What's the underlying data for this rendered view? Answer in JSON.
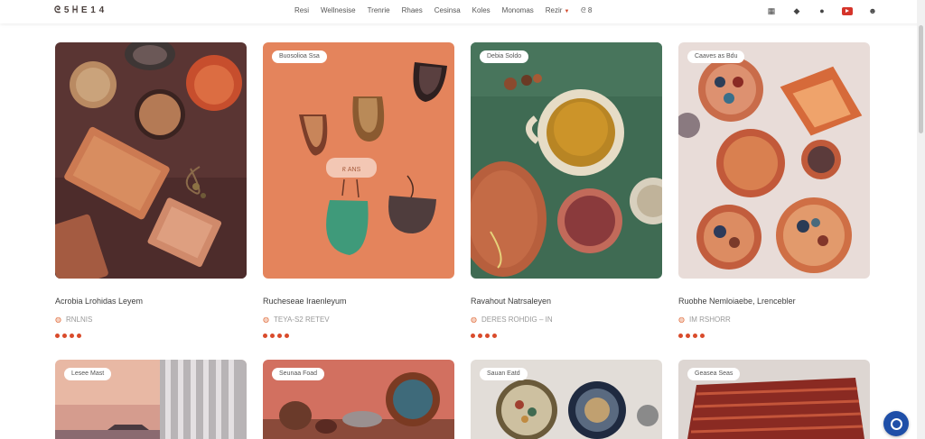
{
  "header": {
    "logo": "ᘓ 5 ᕼ E 1 4",
    "nav": [
      "Resi",
      "Wellnesise",
      "Trenrie",
      "Rhaes",
      "Cesinsa",
      "Koles",
      "Monomas",
      "Rezir"
    ],
    "nav_extra": "ᘓ 8",
    "icons": [
      "grid-icon",
      "bookmark-icon",
      "chat-icon",
      "youtube-icon",
      "user-icon"
    ]
  },
  "cards": [
    {
      "tag": "",
      "title": "Acrobia Lrohidas Leyem",
      "meta": "RNLNIS",
      "rating": 4
    },
    {
      "tag": "Buosolioa Ssa",
      "title": "Rucheseae Iraenleyum",
      "meta": "TEYA-S2 RETEV",
      "rating": 4
    },
    {
      "tag": "Debia Soldo",
      "title": "Ravahout Natrsaleyen",
      "meta": "DERES  ROHDIG – IN",
      "rating": 4
    },
    {
      "tag": "Caaves as Bdu",
      "title": "Ruobhe Nemloiaebe, Lrencebler",
      "meta": "IM RSHORR",
      "rating": 4
    },
    {
      "tag": "Lesee Mast",
      "title": "",
      "meta": "",
      "rating": 0
    },
    {
      "tag": "Seunaa Foad",
      "title": "",
      "meta": "",
      "rating": 0
    },
    {
      "tag": "Sauan Eatd",
      "title": "",
      "meta": "",
      "rating": 0
    },
    {
      "tag": "Geasea Seas",
      "title": "",
      "meta": "",
      "rating": 0
    }
  ],
  "overlay_label": "ᖇ ANS",
  "colors": {
    "accent": "#d94b2b",
    "chat": "#1f4fa8"
  }
}
